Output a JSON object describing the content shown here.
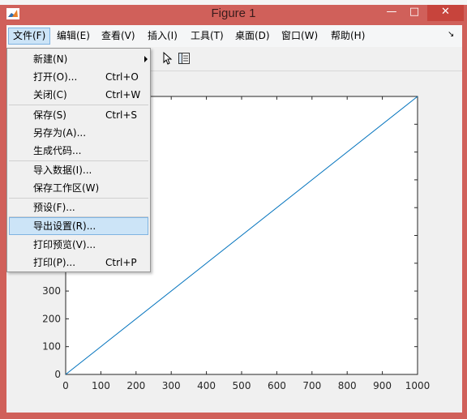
{
  "window": {
    "title": "Figure 1",
    "minimize_glyph": "—",
    "maximize_glyph": "□",
    "close_glyph": "✕"
  },
  "menubar": {
    "items": [
      {
        "label": "文件(F)"
      },
      {
        "label": "编辑(E)"
      },
      {
        "label": "查看(V)"
      },
      {
        "label": "插入(I)"
      },
      {
        "label": "工具(T)"
      },
      {
        "label": "桌面(D)"
      },
      {
        "label": "窗口(W)"
      },
      {
        "label": "帮助(H)"
      }
    ],
    "overflow_glyph": "↘"
  },
  "file_menu": {
    "items": [
      {
        "label": "新建(N)",
        "shortcut": ""
      },
      {
        "label": "打开(O)...",
        "shortcut": "Ctrl+O"
      },
      {
        "label": "关闭(C)",
        "shortcut": "Ctrl+W"
      },
      {
        "label": "保存(S)",
        "shortcut": "Ctrl+S"
      },
      {
        "label": "另存为(A)...",
        "shortcut": ""
      },
      {
        "label": "生成代码...",
        "shortcut": ""
      },
      {
        "label": "导入数据(I)...",
        "shortcut": ""
      },
      {
        "label": "保存工作区(W)",
        "shortcut": ""
      },
      {
        "label": "预设(F)...",
        "shortcut": ""
      },
      {
        "label": "导出设置(R)...",
        "shortcut": ""
      },
      {
        "label": "打印预览(V)...",
        "shortcut": ""
      },
      {
        "label": "打印(P)...",
        "shortcut": "Ctrl+P"
      }
    ],
    "highlighted_item": "导出设置(R)..."
  },
  "icons": {
    "app": "matlab-icon",
    "pointer": "edit-plot-icon",
    "plot_browser": "plot-browser-icon"
  },
  "colors": {
    "frame": "#d0605a",
    "close_button": "#c7443c",
    "line": "#0072bd",
    "highlight": "#cce4f7"
  },
  "chart_data": {
    "type": "line",
    "series": [
      {
        "x": [
          0,
          1000
        ],
        "y": [
          0,
          1000
        ]
      }
    ],
    "xlim": [
      0,
      1000
    ],
    "ylim": [
      0,
      1000
    ],
    "xticks": [
      0,
      100,
      200,
      300,
      400,
      500,
      600,
      700,
      800,
      900,
      1000
    ],
    "yticks_visible": [
      0,
      100,
      200,
      300
    ],
    "grid": false
  }
}
